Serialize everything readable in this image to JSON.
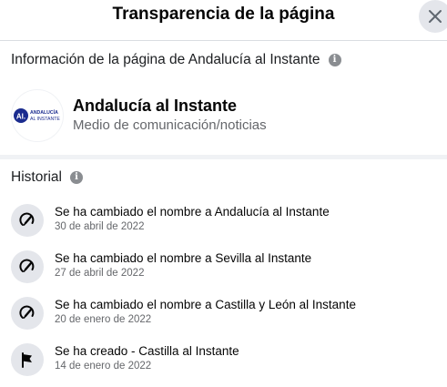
{
  "dialog": {
    "title": "Transparencia de la página",
    "close_icon": "close-icon"
  },
  "page_info": {
    "heading": "Información de la página de Andalucía al Instante",
    "name": "Andalucía al Instante",
    "category": "Medio de comunicación/noticias",
    "logo": {
      "mark": "AI.",
      "line1": "ANDALUCÍA",
      "line2": "AL INSTANTE"
    }
  },
  "history": {
    "heading": "Historial",
    "items": [
      {
        "icon": "edit-name-icon",
        "title": "Se ha cambiado el nombre a Andalucía al Instante",
        "date": "30 de abril de 2022"
      },
      {
        "icon": "edit-name-icon",
        "title": "Se ha cambiado el nombre a Sevilla al Instante",
        "date": "27 de abril de 2022"
      },
      {
        "icon": "edit-name-icon",
        "title": "Se ha cambiado el nombre a Castilla y León al Instante",
        "date": "20 de enero de 2022"
      },
      {
        "icon": "flag-icon",
        "title": "Se ha creado - Castilla al Instante",
        "date": "14 de enero de 2022"
      }
    ]
  },
  "colors": {
    "brand": "#1b2c8f",
    "text_primary": "#050505",
    "text_secondary": "#65676b",
    "icon_bg": "#e4e6eb"
  }
}
